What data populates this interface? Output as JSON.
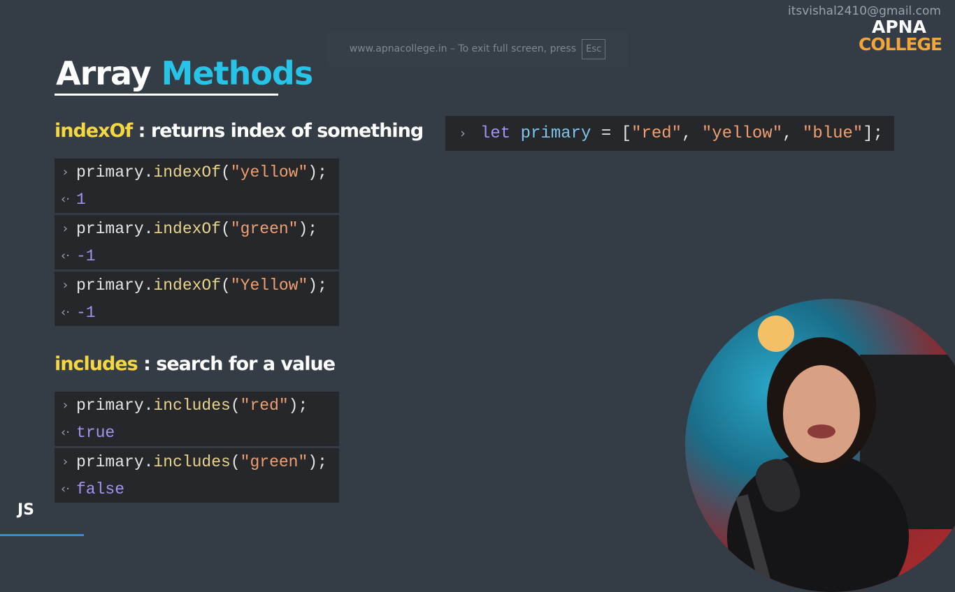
{
  "header": {
    "email": "itsvishal2410@gmail.com",
    "logo_line1": "APNA",
    "logo_line2": "COLLEGE"
  },
  "fullscreen_notice": {
    "text": "www.apnacollege.in – To exit full screen, press",
    "key": "Esc"
  },
  "title": {
    "word1": "Array",
    "word2": "Methods"
  },
  "top_code": {
    "keyword": "let",
    "var": "primary",
    "eq": " = [",
    "s1": "\"red\"",
    "c1": ", ",
    "s2": "\"yellow\"",
    "c2": ", ",
    "s3": "\"blue\"",
    "end": "];"
  },
  "indexof": {
    "keyword": "indexOf",
    "desc": " : returns index of something",
    "examples": [
      {
        "obj": "primary.",
        "method": "indexOf",
        "open": "(",
        "arg": "\"yellow\"",
        "close": ");",
        "result": "1"
      },
      {
        "obj": "primary.",
        "method": "indexOf",
        "open": "(",
        "arg": "\"green\"",
        "close": ");",
        "result": "-1"
      },
      {
        "obj": "primary.",
        "method": "indexOf",
        "open": "(",
        "arg": "\"Yellow\"",
        "close": ");",
        "result": "-1"
      }
    ]
  },
  "includes": {
    "keyword": "includes",
    "desc": " : search for a value",
    "examples": [
      {
        "obj": "primary.",
        "method": "includes",
        "open": "(",
        "arg": "\"red\"",
        "close": ");",
        "result": "true"
      },
      {
        "obj": "primary.",
        "method": "includes",
        "open": "(",
        "arg": "\"green\"",
        "close": ");",
        "result": "false"
      }
    ]
  },
  "footer": {
    "label": "JS"
  },
  "icons": {
    "prompt": "chevron-right-icon",
    "result": "return-arrow-icon"
  }
}
